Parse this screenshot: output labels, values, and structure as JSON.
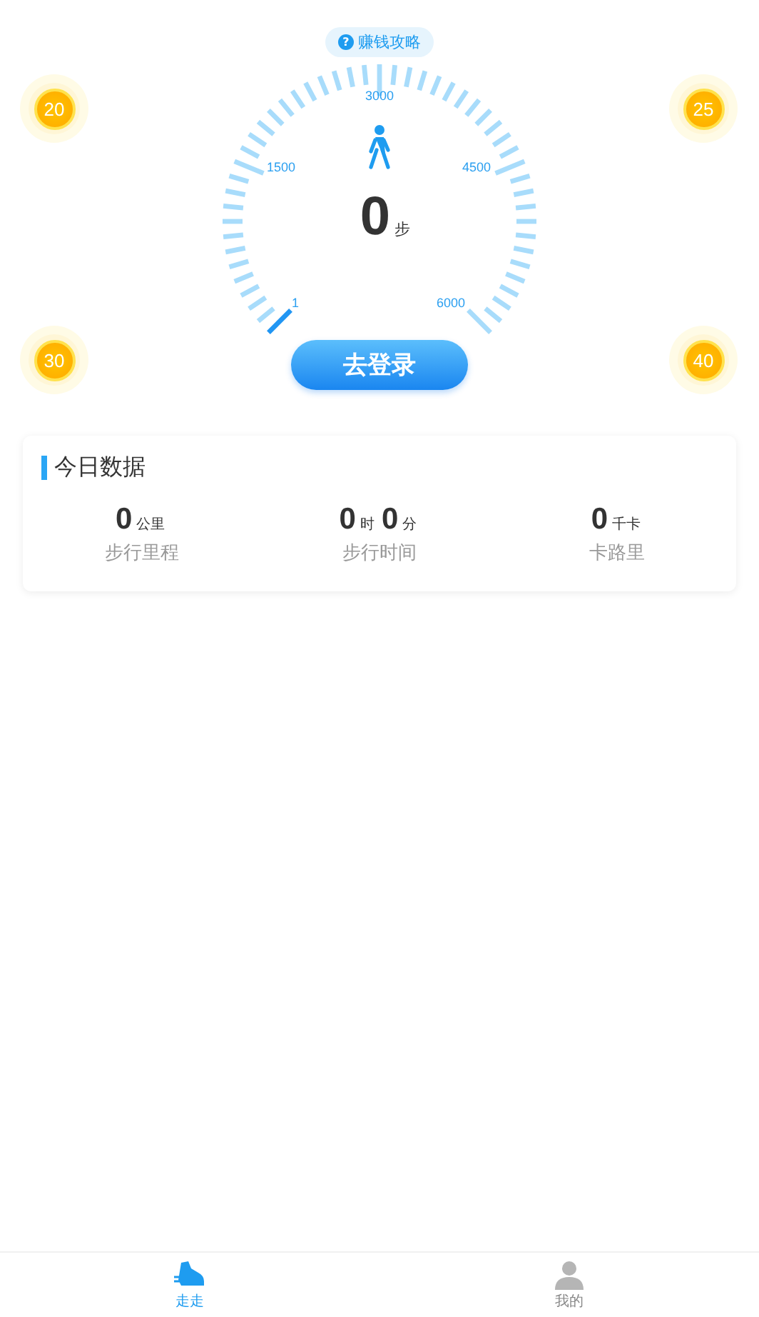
{
  "guide_badge": {
    "icon": "?",
    "label": "赚钱攻略"
  },
  "coins": [
    {
      "value": "20"
    },
    {
      "value": "25"
    },
    {
      "value": "30"
    },
    {
      "value": "40"
    }
  ],
  "gauge": {
    "labels": [
      "1",
      "1500",
      "3000",
      "4500",
      "6000"
    ],
    "steps": "0",
    "unit": "步"
  },
  "login_button": "去登录",
  "today": {
    "title": "今日数据",
    "stats": [
      {
        "parts": [
          {
            "value": "0",
            "unit": "公里"
          }
        ],
        "label": "步行里程"
      },
      {
        "parts": [
          {
            "value": "0",
            "unit": "时"
          },
          {
            "value": "0",
            "unit": "分"
          }
        ],
        "label": "步行时间"
      },
      {
        "parts": [
          {
            "value": "0",
            "unit": "千卡"
          }
        ],
        "label": "卡路里"
      }
    ]
  },
  "tab_bar": [
    {
      "kind": "shoe",
      "label": "走走",
      "selected": true
    },
    {
      "kind": "person",
      "label": "我的",
      "selected": false
    }
  ]
}
